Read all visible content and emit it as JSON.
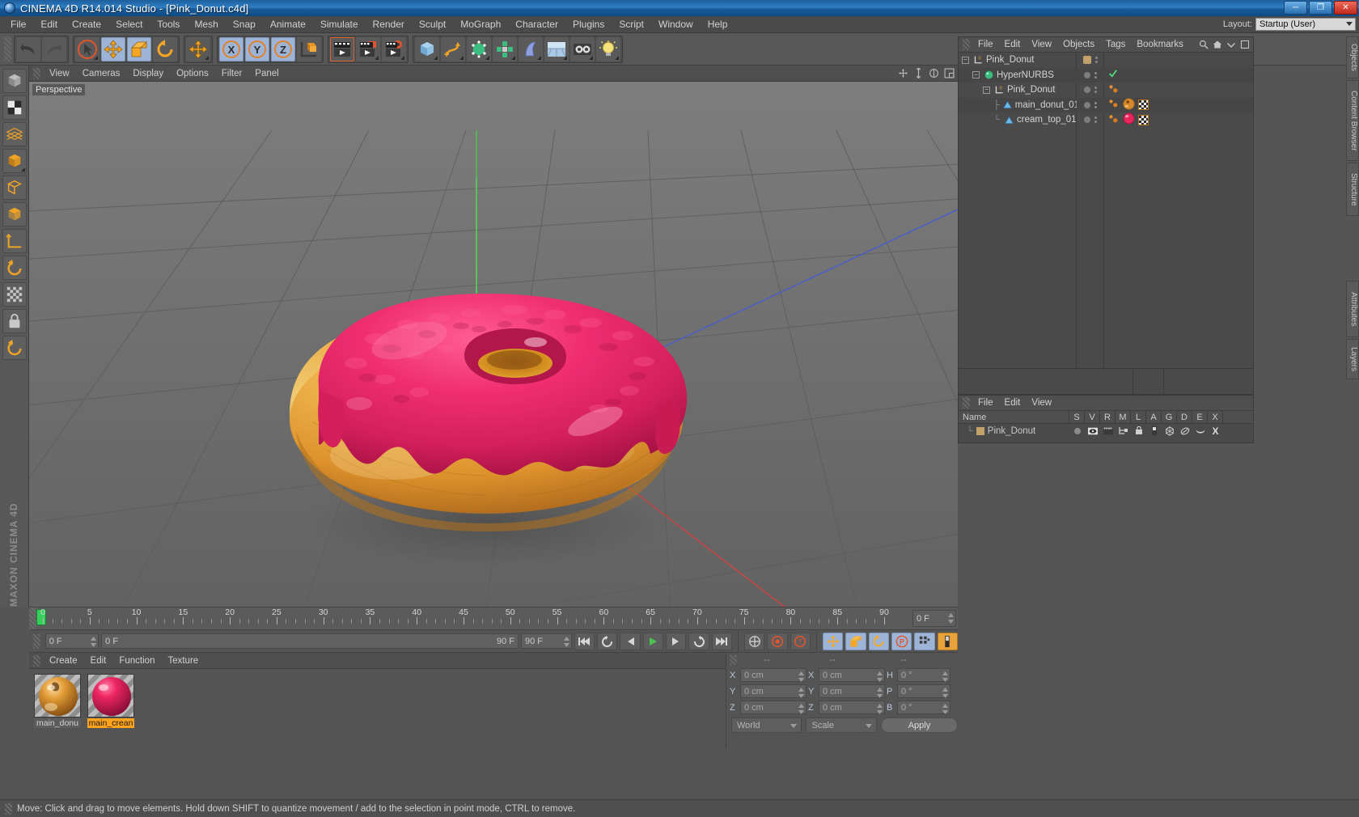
{
  "window": {
    "title": "CINEMA 4D R14.014 Studio - [Pink_Donut.c4d]",
    "minimize": "─",
    "maximize": "❐",
    "close": "✕"
  },
  "menubar": {
    "items": [
      "File",
      "Edit",
      "Create",
      "Select",
      "Tools",
      "Mesh",
      "Snap",
      "Animate",
      "Simulate",
      "Render",
      "Sculpt",
      "MoGraph",
      "Character",
      "Plugins",
      "Script",
      "Window",
      "Help"
    ],
    "layout_label": "Layout:",
    "layout_value": "Startup (User)"
  },
  "viewport": {
    "menu": [
      "View",
      "Cameras",
      "Display",
      "Options",
      "Filter",
      "Panel"
    ],
    "label": "Perspective",
    "axis": {
      "x": "X",
      "y": "Y",
      "z": "Z"
    },
    "colors": {
      "icing": "#e7306e",
      "icing_dark": "#b01a4c",
      "dough": "#e9a03a",
      "dough_light": "#f2cf7a",
      "dough_dark": "#c07620",
      "grid": "#5b5b5b",
      "axis_x": "#d04646",
      "axis_y": "#46b04a",
      "axis_z": "#4a5ec8"
    }
  },
  "timeline": {
    "ticks": [
      "0",
      "5",
      "10",
      "15",
      "20",
      "25",
      "30",
      "35",
      "40",
      "45",
      "50",
      "55",
      "60",
      "65",
      "70",
      "75",
      "80",
      "85",
      "90"
    ],
    "current_frame_field": "0 F",
    "start_field": "0 F",
    "end_field": "90 F",
    "range_field": "90 F",
    "preview_field": "0 F"
  },
  "materials": {
    "menu": [
      "Create",
      "Edit",
      "Function",
      "Texture"
    ],
    "items": [
      {
        "name": "main_donu",
        "color": "#d98327",
        "selected": false
      },
      {
        "name": "main_crean",
        "color": "#e7265e",
        "selected": true
      }
    ]
  },
  "coordinates": {
    "headers": [
      "--",
      "--",
      "--"
    ],
    "rows": [
      {
        "l1": "X",
        "v1": "0 cm",
        "l2": "X",
        "v2": "0 cm",
        "l3": "H",
        "v3": "0 °"
      },
      {
        "l1": "Y",
        "v1": "0 cm",
        "l2": "Y",
        "v2": "0 cm",
        "l3": "P",
        "v3": "0 °"
      },
      {
        "l1": "Z",
        "v1": "0 cm",
        "l2": "Z",
        "v2": "0 cm",
        "l3": "B",
        "v3": "0 °"
      }
    ],
    "system": "World",
    "mode": "Scale",
    "apply": "Apply"
  },
  "objects": {
    "menu": [
      "File",
      "Edit",
      "View",
      "Objects",
      "Tags",
      "Bookmarks"
    ],
    "rows": [
      {
        "name": "Pink_Donut",
        "indent": 0,
        "icon": "null-object-icon",
        "expander": "−",
        "tag_color": "#c2a06a",
        "check": false,
        "tags": []
      },
      {
        "name": "HyperNURBS",
        "indent": 1,
        "icon": "hypernurbs-icon",
        "expander": "−",
        "tag_color": "#7d7d7d",
        "check": true,
        "tags": []
      },
      {
        "name": "Pink_Donut",
        "indent": 2,
        "icon": "null-object-icon",
        "expander": "−",
        "tag_color": "#7d7d7d",
        "check": false,
        "tags": [
          "dots"
        ]
      },
      {
        "name": "main_donut_01",
        "indent": 3,
        "icon": "polygon-object-icon",
        "expander": "",
        "tag_color": "#7d7d7d",
        "check": false,
        "tags": [
          "dots",
          "material-donut",
          "uv-checker"
        ]
      },
      {
        "name": "cream_top_01",
        "indent": 3,
        "icon": "polygon-object-icon",
        "expander": "",
        "tag_color": "#7d7d7d",
        "check": false,
        "tags": [
          "dots",
          "material-cream",
          "uv-checker"
        ]
      }
    ]
  },
  "attributes": {
    "menu": []
  },
  "layers": {
    "menu": [
      "File",
      "Edit",
      "View"
    ],
    "columns": [
      "Name",
      "S",
      "V",
      "R",
      "M",
      "L",
      "A",
      "G",
      "D",
      "E",
      "X"
    ],
    "rows": [
      {
        "name": "Pink_Donut",
        "color": "#c2a06a"
      }
    ]
  },
  "dock_tabs": [
    "Objects",
    "Content Browser",
    "Structure",
    "Attributes",
    "Layers"
  ],
  "statusbar": {
    "text": "Move: Click and drag to move elements. Hold down SHIFT to quantize movement / add to the selection in point mode, CTRL to remove."
  },
  "branding": {
    "text": "MAXON CINEMA 4D"
  }
}
